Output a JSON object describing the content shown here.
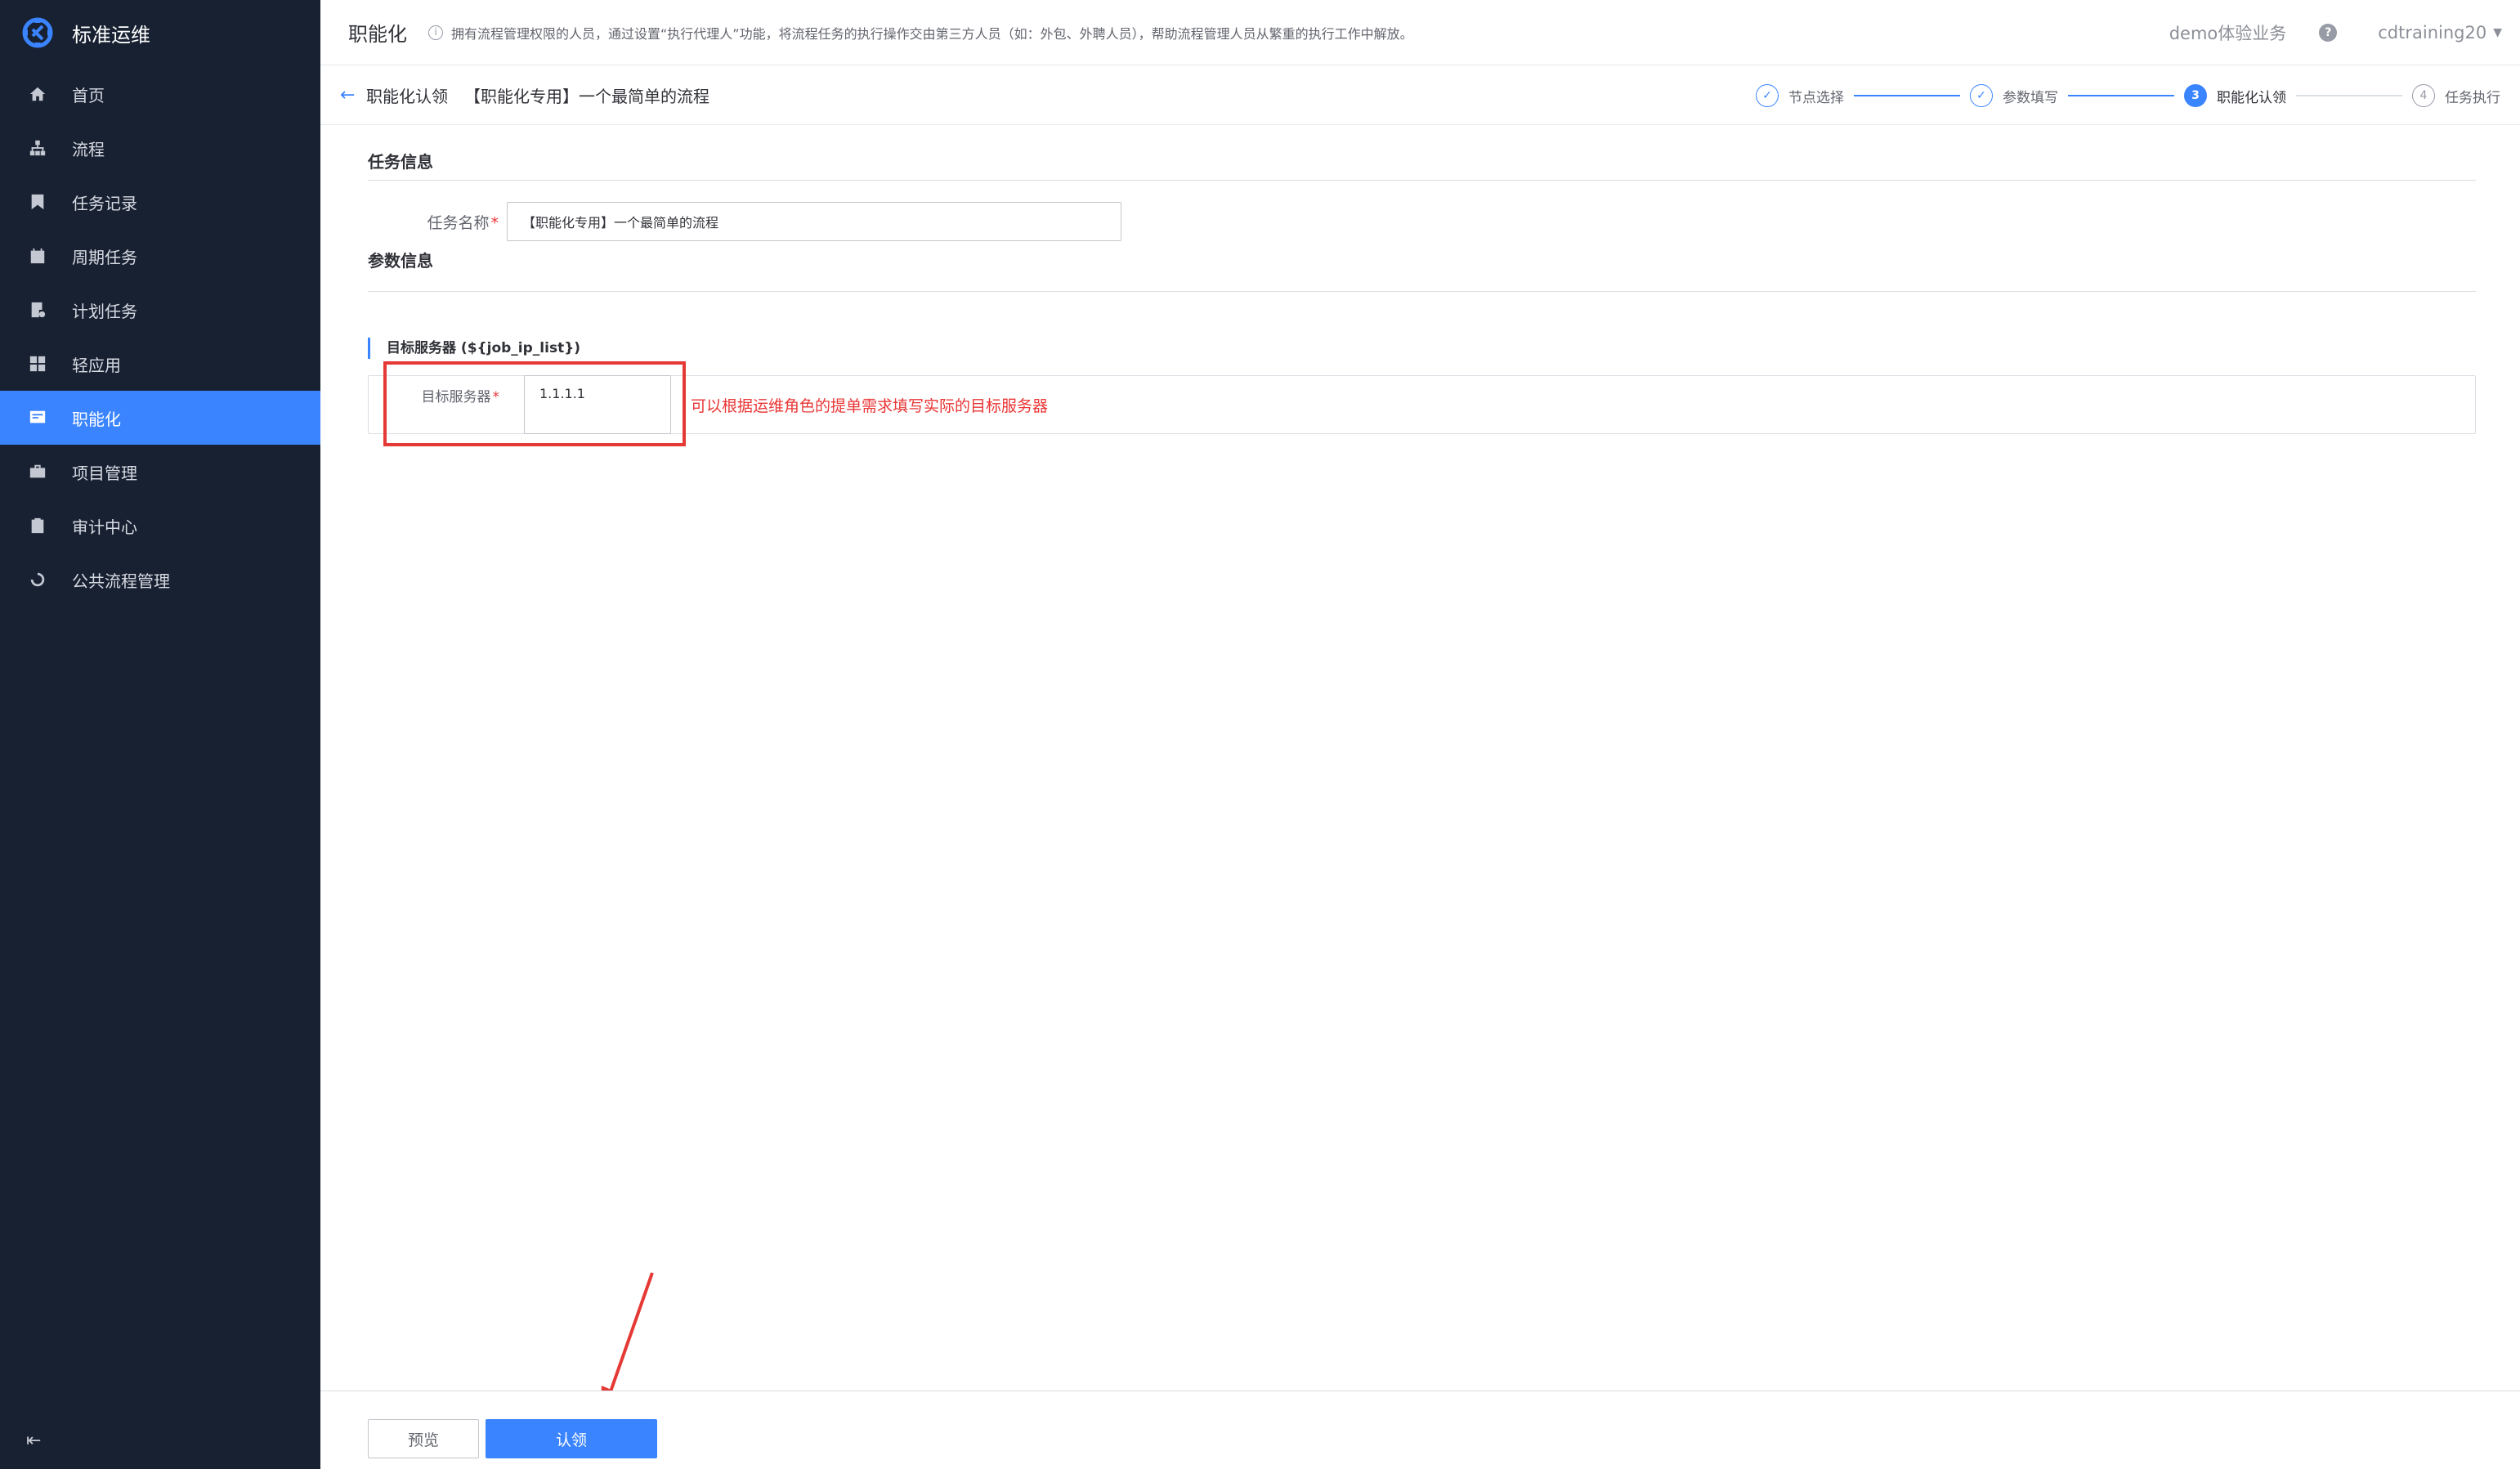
{
  "sidebar": {
    "brand": "标准运维",
    "items": [
      {
        "label": "首页",
        "icon": "home-icon"
      },
      {
        "label": "流程",
        "icon": "sitemap-icon"
      },
      {
        "label": "任务记录",
        "icon": "bookmark-icon"
      },
      {
        "label": "周期任务",
        "icon": "calendar-icon"
      },
      {
        "label": "计划任务",
        "icon": "plan-icon"
      },
      {
        "label": "轻应用",
        "icon": "grid-icon"
      },
      {
        "label": "职能化",
        "icon": "function-icon",
        "active": true
      },
      {
        "label": "项目管理",
        "icon": "project-icon"
      },
      {
        "label": "审计中心",
        "icon": "clipboard-icon"
      },
      {
        "label": "公共流程管理",
        "icon": "cycle-icon"
      }
    ],
    "collapse_icon": "collapse-icon"
  },
  "header": {
    "title": "职能化",
    "tip": "拥有流程管理权限的人员，通过设置“执行代理人”功能，将流程任务的执行操作交由第三方人员（如：外包、外聘人员），帮助流程管理人员从繁重的执行工作中解放。",
    "business": "demo体验业务",
    "user": "cdtraining20"
  },
  "subbar": {
    "back_label": "职能化认领",
    "flow_name": "【职能化专用】一个最简单的流程",
    "steps": [
      {
        "index": "✓",
        "label": "节点选择",
        "state": "done"
      },
      {
        "index": "✓",
        "label": "参数填写",
        "state": "done"
      },
      {
        "index": "3",
        "label": "职能化认领",
        "state": "current"
      },
      {
        "index": "4",
        "label": "任务执行",
        "state": "todo"
      }
    ]
  },
  "task_info": {
    "section_title": "任务信息",
    "name_label": "任务名称",
    "name_value": "【职能化专用】一个最简单的流程"
  },
  "param_info": {
    "section_title": "参数信息",
    "group_title": "目标服务器 (${job_ip_list})",
    "field_label": "目标服务器",
    "field_value": "1.1.1.1",
    "note": "可以根据运维角色的提单需求填写实际的目标服务器"
  },
  "footer": {
    "preview_label": "预览",
    "claim_label": "认领"
  },
  "colors": {
    "accent": "#3a84ff",
    "sidebar_bg": "#182132",
    "annotation": "#e53935"
  }
}
